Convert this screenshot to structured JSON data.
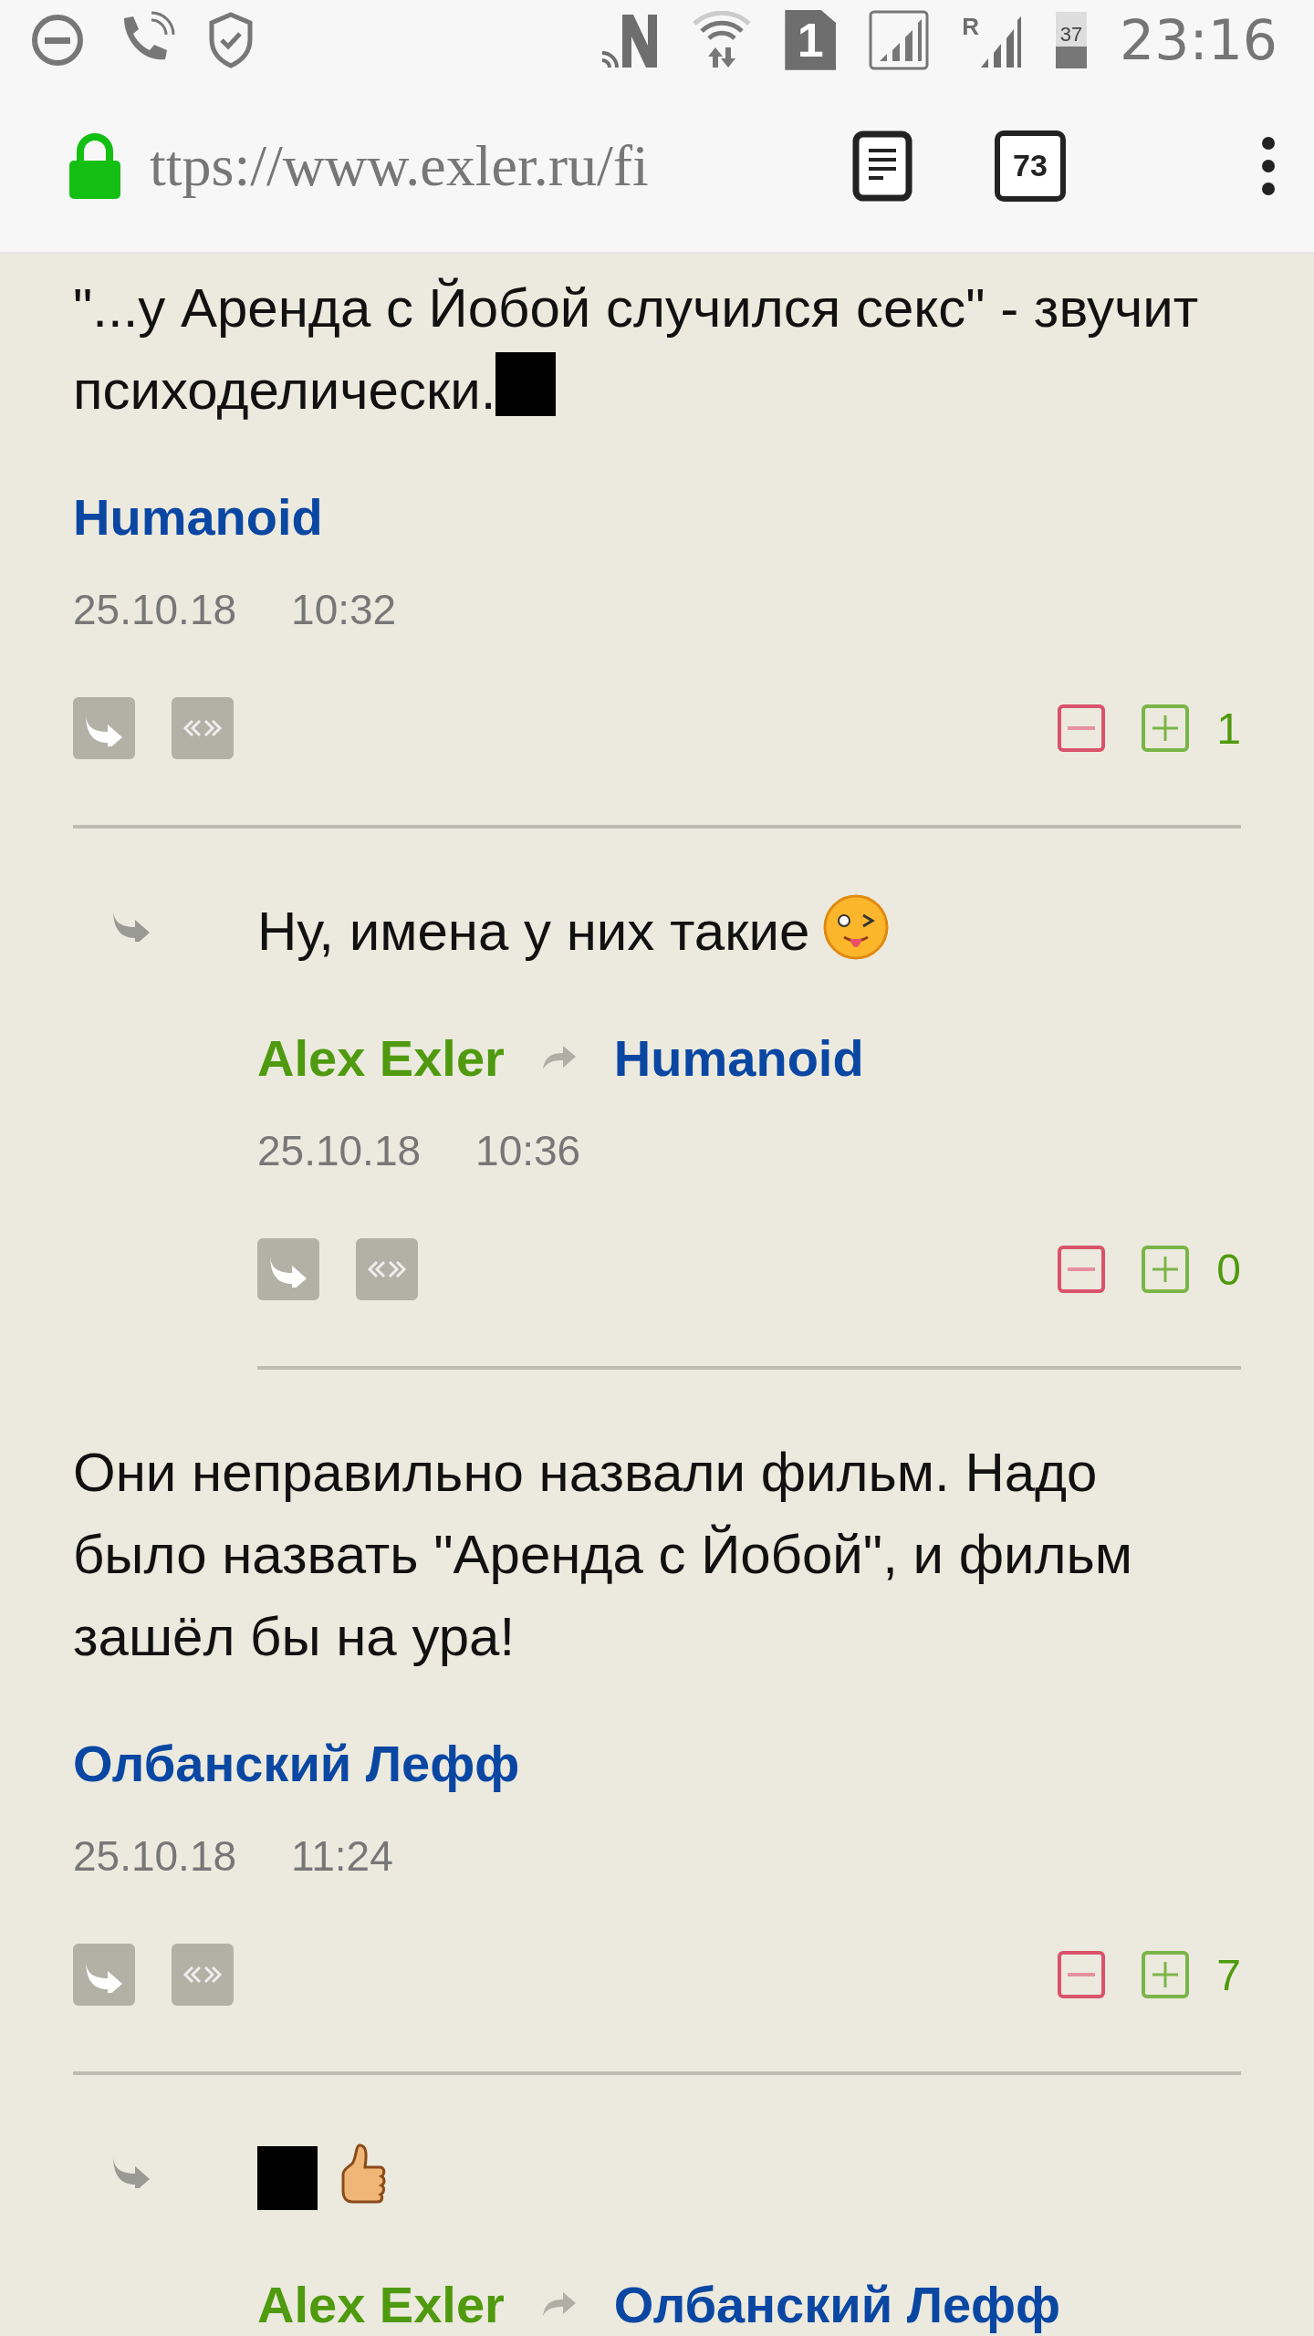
{
  "status_bar": {
    "sim_slot": "1",
    "roaming": "R",
    "battery": "37",
    "time": "23:16"
  },
  "browser": {
    "url": "ttps://www.exler.ru/fi",
    "tab_count": "73"
  },
  "comments": [
    {
      "kind": "top",
      "text": "\"...у Аренда с Йобой случился секс\" - звучит психоделически.",
      "glyphs": [
        {
          "kind": "missing"
        }
      ],
      "author": {
        "name": "Humanoid",
        "color": "#0a47a3"
      },
      "date": "25.10.18",
      "time": "10:32",
      "score": "1"
    },
    {
      "kind": "reply",
      "text": "Ну, имена у них такие",
      "glyphs": [
        {
          "kind": "wink"
        }
      ],
      "author": {
        "name": "Alex Exler",
        "color": "#4f9a0f"
      },
      "reply_to": {
        "name": "Humanoid",
        "color": "#0a47a3"
      },
      "date": "25.10.18",
      "time": "10:36",
      "score": "0"
    },
    {
      "kind": "top",
      "text": "Они неправильно назвали фильм. Надо было назвать \"Аренда с Йобой\", и фильм зашёл бы на ура!",
      "author": {
        "name": "Олбанский Лефф",
        "color": "#0a47a3"
      },
      "date": "25.10.18",
      "time": "11:24",
      "score": "7"
    },
    {
      "kind": "reply",
      "glyphs": [
        {
          "kind": "missing"
        },
        {
          "kind": "thumb"
        }
      ],
      "author": {
        "name": "Alex Exler",
        "color": "#4f9a0f"
      },
      "reply_to": {
        "name": "Олбанский Лефф",
        "color": "#0a47a3"
      }
    }
  ]
}
